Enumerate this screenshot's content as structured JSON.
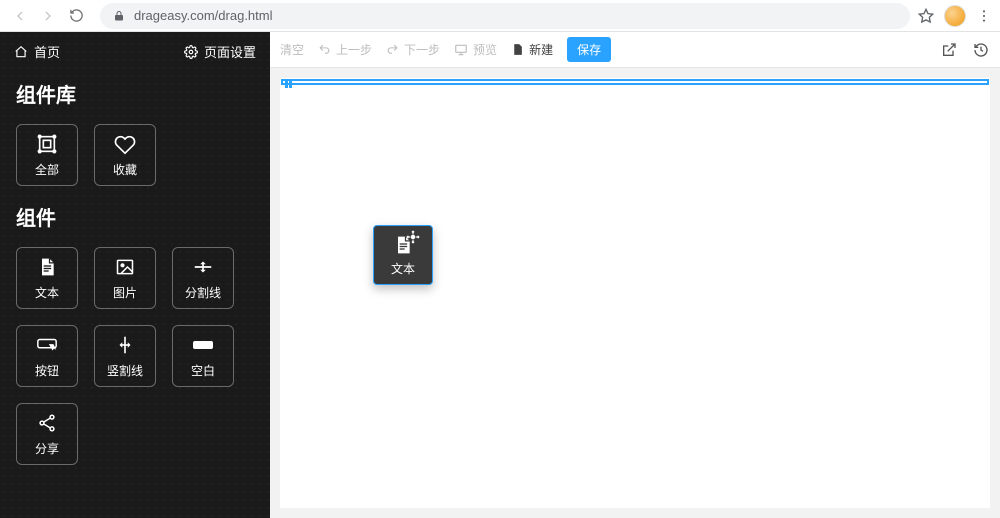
{
  "browser": {
    "url": "drageasy.com/drag.html"
  },
  "sidebar": {
    "home_label": "首页",
    "page_settings_label": "页面设置",
    "library_title": "组件库",
    "library_items": [
      {
        "icon": "select-all-icon",
        "label": "全部"
      },
      {
        "icon": "heart-icon",
        "label": "收藏"
      }
    ],
    "components_title": "组件",
    "component_items": [
      {
        "icon": "file-text-icon",
        "label": "文本"
      },
      {
        "icon": "image-icon",
        "label": "图片"
      },
      {
        "icon": "divider-h-icon",
        "label": "分割线"
      },
      {
        "icon": "button-icon",
        "label": "按钮"
      },
      {
        "icon": "divider-v-icon",
        "label": "竖割线"
      },
      {
        "icon": "blank-icon",
        "label": "空白"
      },
      {
        "icon": "share-icon",
        "label": "分享"
      }
    ]
  },
  "toolbar": {
    "clear": "清空",
    "undo": "上一步",
    "redo": "下一步",
    "preview": "预览",
    "new": "新建",
    "save": "保存"
  },
  "canvas": {
    "ghost_label": "文本"
  }
}
